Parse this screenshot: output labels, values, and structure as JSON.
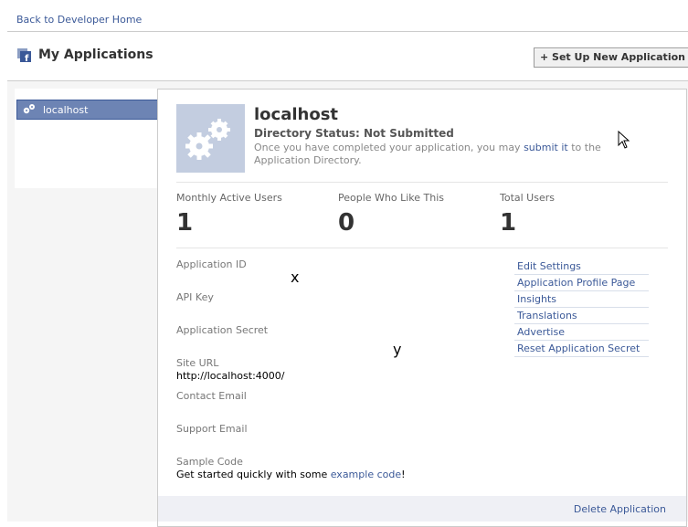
{
  "nav": {
    "back_link": "Back to Developer Home"
  },
  "header": {
    "title": "My Applications",
    "new_app_button": "+ Set Up New Application"
  },
  "sidebar": {
    "items": [
      {
        "label": "localhost",
        "selected": true
      }
    ]
  },
  "app": {
    "name": "localhost",
    "directory_status": "Directory Status: Not Submitted",
    "note_before": "Once you have completed your application, you may ",
    "note_link": "submit it",
    "note_after": " to the Application Directory."
  },
  "stats": [
    {
      "label": "Monthly Active Users",
      "value": "1"
    },
    {
      "label": "People Who Like This",
      "value": "0"
    },
    {
      "label": "Total Users",
      "value": "1"
    }
  ],
  "fields": [
    {
      "label": "Application ID",
      "value": ""
    },
    {
      "label": "API Key",
      "value": ""
    },
    {
      "label": "Application Secret",
      "value": ""
    },
    {
      "label": "Site URL",
      "value": "http://localhost:4000/"
    },
    {
      "label": "Contact Email",
      "value": ""
    },
    {
      "label": "Support Email",
      "value": ""
    },
    {
      "label": "Sample Code",
      "value_before": "Get started quickly with some ",
      "value_link": "example code",
      "value_after": "!"
    }
  ],
  "actions": [
    "Edit Settings",
    "Application Profile Page",
    "Insights",
    "Translations",
    "Advertise",
    "Reset Application Secret"
  ],
  "footer": {
    "delete_link": "Delete Application"
  },
  "overlays": {
    "x": "x",
    "y": "y"
  },
  "colors": {
    "link": "#3b5998",
    "selected": "#6d84b4",
    "logo_bg": "#c3cde0",
    "footer_bg": "#eff0f5"
  }
}
